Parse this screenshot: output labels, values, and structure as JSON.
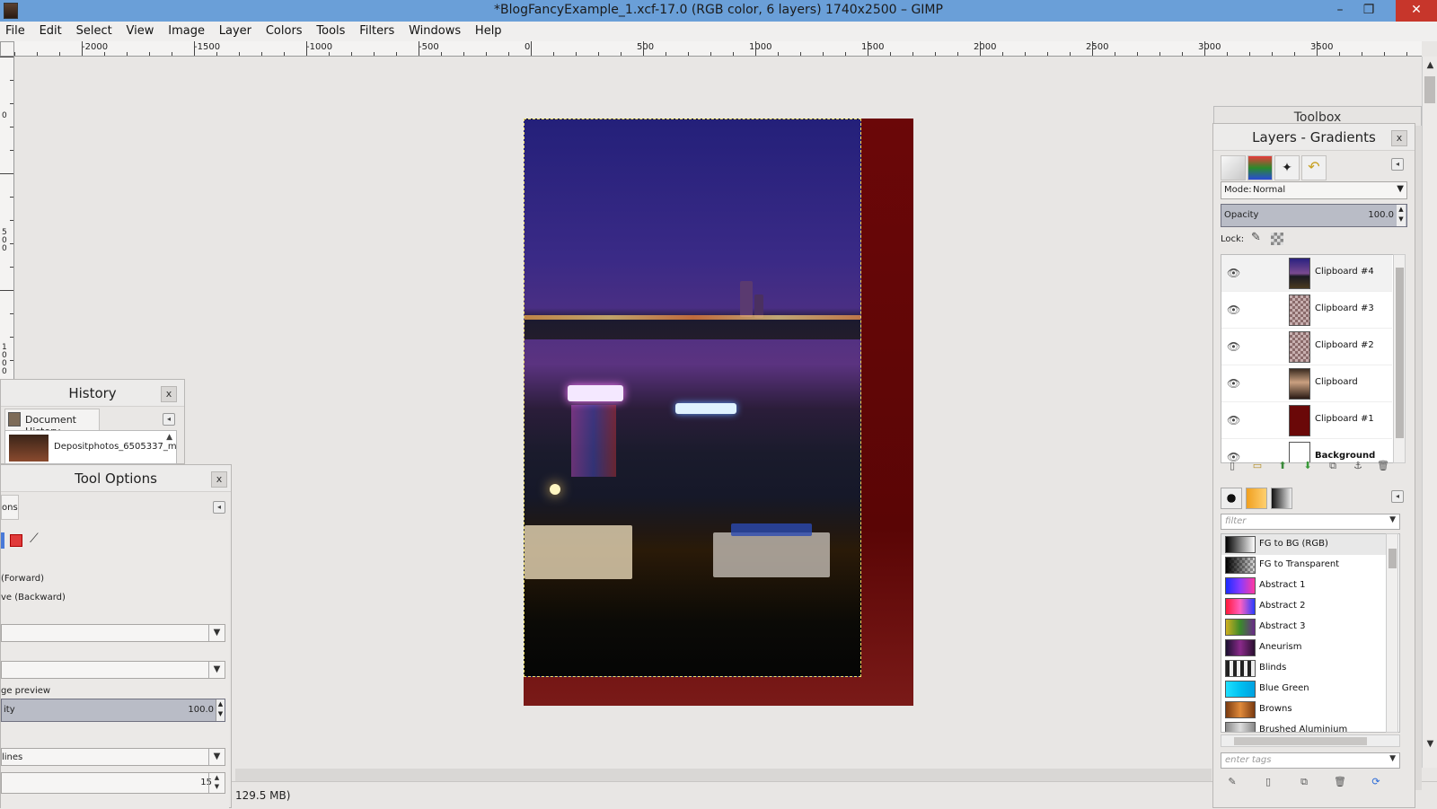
{
  "window": {
    "title": "*BlogFancyExample_1.xcf-17.0 (RGB color, 6 layers) 1740x2500 – GIMP",
    "minimize": "–",
    "restore": "❐",
    "close": "✕"
  },
  "menubar": [
    "File",
    "Edit",
    "Select",
    "View",
    "Image",
    "Layer",
    "Colors",
    "Tools",
    "Filters",
    "Windows",
    "Help"
  ],
  "ruler_h": [
    "-2000",
    "-1500",
    "-1000",
    "-500",
    "0",
    "500",
    "1000",
    "1500",
    "2000",
    "2500",
    "3000",
    "3500"
  ],
  "ruler_v": [
    "0",
    "500",
    "1000"
  ],
  "status": "129.5 MB)",
  "toolbox": {
    "title": "Toolbox"
  },
  "history": {
    "title": "History",
    "tab": "Document History",
    "item": "Depositphotos_6505337_m"
  },
  "tool_options": {
    "title": "Tool Options",
    "tab": "ons",
    "forward": "(Forward)",
    "backward": "ve (Backward)",
    "preview": "ge preview",
    "slider_label": "ity",
    "slider_value": "100.0",
    "combo3": "lines",
    "spin_value": "15"
  },
  "layers": {
    "title": "Layers - Gradients",
    "mode_label": "Mode:",
    "mode_value": "Normal",
    "opacity_label": "Opacity",
    "opacity_value": "100.0",
    "lock_label": "Lock:",
    "items": [
      {
        "name": "Clipboard #4",
        "thumb": "photo"
      },
      {
        "name": "Clipboard #3",
        "thumb": "checker"
      },
      {
        "name": "Clipboard #2",
        "thumb": "checker"
      },
      {
        "name": "Clipboard",
        "thumb": "portrait"
      },
      {
        "name": "Clipboard #1",
        "thumb": "red"
      },
      {
        "name": "Background",
        "thumb": "white"
      }
    ]
  },
  "gradients": {
    "filter_placeholder": "filter",
    "tags_placeholder": "enter tags",
    "items": [
      {
        "name": "FG to BG (RGB)",
        "colors": [
          "#000000",
          "#ffffff"
        ]
      },
      {
        "name": "FG to Transparent",
        "colors": [
          "#000000",
          "#c8c8c8"
        ]
      },
      {
        "name": "Abstract 1",
        "colors": [
          "#1a2cff",
          "#ff3aa0"
        ]
      },
      {
        "name": "Abstract 2",
        "colors": [
          "#ff1a3a",
          "#2a3cff"
        ]
      },
      {
        "name": "Abstract 3",
        "colors": [
          "#d0b020",
          "#3a8a2a"
        ]
      },
      {
        "name": "Aneurism",
        "colors": [
          "#1a1030",
          "#8a2a8a"
        ]
      },
      {
        "name": "Blinds",
        "colors": [
          "#222222",
          "#eeeeee"
        ]
      },
      {
        "name": "Blue Green",
        "colors": [
          "#20e0ff",
          "#00a0e0"
        ]
      },
      {
        "name": "Browns",
        "colors": [
          "#7a3a10",
          "#e08a3a"
        ]
      },
      {
        "name": "Brushed Aluminium",
        "colors": [
          "#888888",
          "#dddddd"
        ]
      }
    ]
  }
}
